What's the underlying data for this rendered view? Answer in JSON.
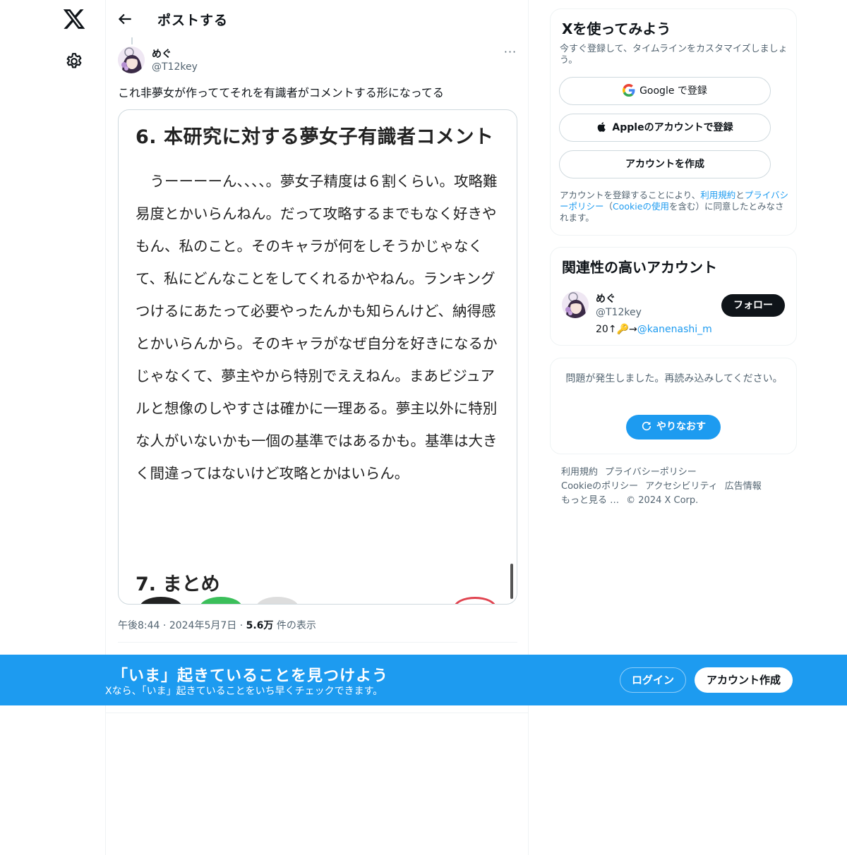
{
  "nav": {
    "logo_icon": "x-logo-icon",
    "settings_icon": "gear-icon"
  },
  "header": {
    "title": "ポストする"
  },
  "post": {
    "author_name": "めぐ",
    "author_handle": "@T12key",
    "more_label": "···",
    "text": "これ非夢女が作っててそれを有識者がコメントする形になってる",
    "image": {
      "heading": "6. 本研究に対する夢女子有識者コメント",
      "body": "うーーーーん、、、、。夢女子精度は６割くらい。攻略難易度とかいらんねん。だって攻略するまでもなく好きやもん、私のこと。そのキャラが何をしそうかじゃなくて、私にどんなことをしてくれるかやねん。ランキングつけるにあたって必要やったんかも知らんけど、納得感とかいらんから。そのキャラがなぜ自分を好きになるかじゃなくて、夢主やから特別でええねん。まあビジュアルと想像のしやすさは確かに一理ある。夢主以外に特別な人がいないかも一個の基準ではあるかも。基準は大きく間違ってはないけど攻略とかはいらん。",
      "next_heading": "7. まとめ"
    },
    "time": "午後8:44",
    "date": "2024年5月7日",
    "views_count": "5.6万",
    "views_label": "件の表示"
  },
  "signup_card": {
    "title": "Xを使ってみよう",
    "subtitle": "今すぐ登録して、タイムラインをカスタマイズしましょう。",
    "google_label": "Google で登録",
    "apple_label": "Appleのアカウントで登録",
    "create_label": "アカウントを作成",
    "legal_prefix": "アカウントを登録することにより、",
    "terms_link": "利用規約",
    "legal_and": "と",
    "privacy_link": "プライバシーポリシー",
    "legal_paren_open": "（",
    "cookie_link": "Cookieの使用",
    "legal_suffix": "を含む）に同意したとみなされます。"
  },
  "related": {
    "title": "関連性の高いアカウント",
    "name": "めぐ",
    "handle": "@T12key",
    "bio_prefix": "20↑🔑→",
    "bio_link": "@kanenashi_m",
    "follow_label": "フォロー"
  },
  "error_card": {
    "message": "問題が発生しました。再読み込みしてください。",
    "retry_label": "やりなおす"
  },
  "footer": {
    "links": [
      "利用規約",
      "プライバシーポリシー",
      "Cookieのポリシー",
      "アクセシビリティ",
      "広告情報",
      "もっと見る …"
    ],
    "copyright": "© 2024 X Corp."
  },
  "banner": {
    "title": "「いま」起きていることを見つけよう",
    "subtitle": "Xなら、「いま」起きていることをいち早くチェックできます。",
    "login_label": "ログイン",
    "create_label": "アカウント作成"
  },
  "colors": {
    "accent": "#1d9bf0",
    "text": "#0f1419",
    "muted": "#536471"
  }
}
